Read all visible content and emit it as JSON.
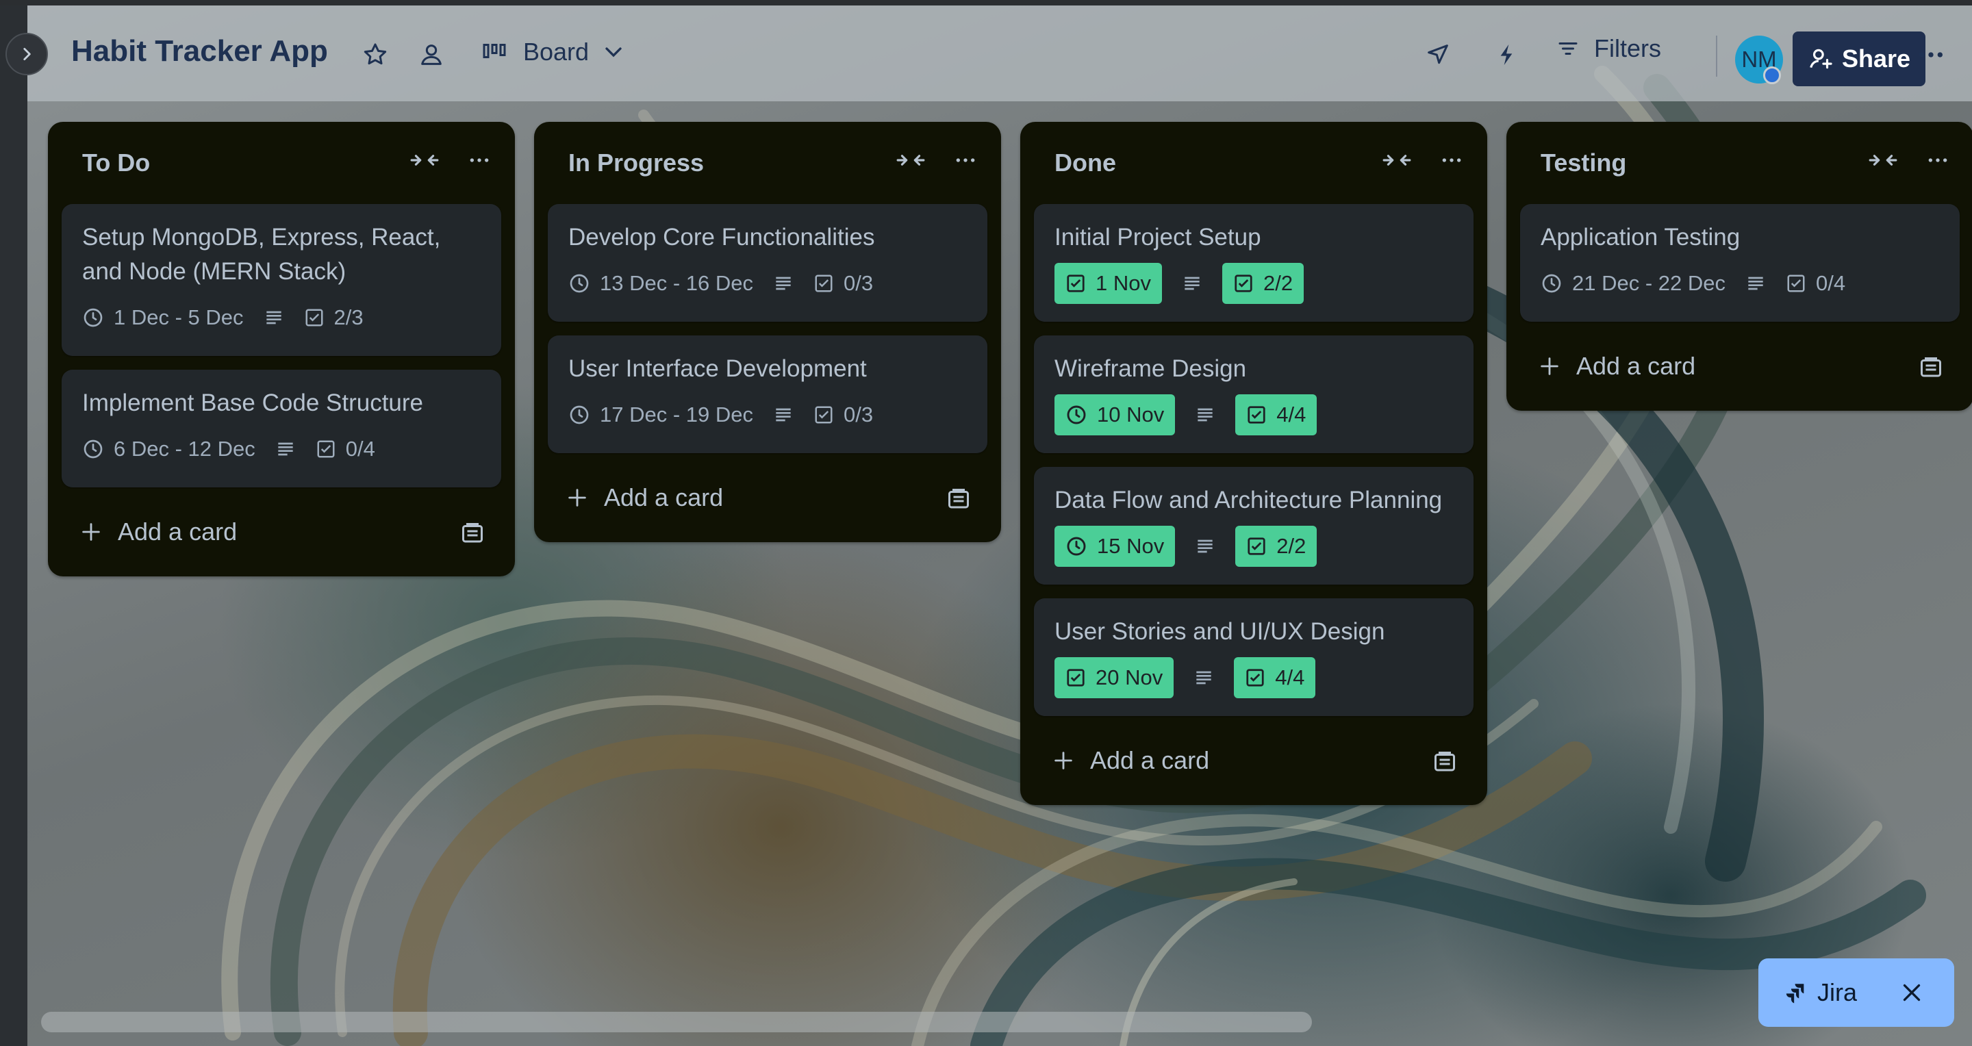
{
  "header": {
    "board_title": "Habit Tracker App",
    "view_label": "Board",
    "filters_label": "Filters",
    "avatar_initials": "NM",
    "share_label": "Share"
  },
  "lists": [
    {
      "title": "To Do",
      "cards": [
        {
          "title": "Setup MongoDB, Express, React, and Node (MERN Stack)",
          "dates": "1 Dec - 5 Dec",
          "checklist": "2/3"
        },
        {
          "title": "Implement Base Code Structure",
          "dates": "6 Dec - 12 Dec",
          "checklist": "0/4"
        }
      ],
      "add_label": "Add a card"
    },
    {
      "title": "In Progress",
      "cards": [
        {
          "title": "Develop Core Functionalities",
          "dates": "13 Dec - 16 Dec",
          "checklist": "0/3"
        },
        {
          "title": "User Interface Development",
          "dates": "17 Dec - 19 Dec",
          "checklist": "0/3"
        }
      ],
      "add_label": "Add a card"
    },
    {
      "title": "Done",
      "cards": [
        {
          "title": "Initial Project Setup",
          "dates": "1 Nov",
          "checklist": "2/2"
        },
        {
          "title": "Wireframe Design",
          "dates": "10 Nov",
          "checklist": "4/4"
        },
        {
          "title": "Data Flow and Architecture Planning",
          "dates": "15 Nov",
          "checklist": "2/2"
        },
        {
          "title": "User Stories and UI/UX Design",
          "dates": "20 Nov",
          "checklist": "4/4"
        }
      ],
      "add_label": "Add a card"
    },
    {
      "title": "Testing",
      "cards": [
        {
          "title": "Application Testing",
          "dates": "21 Dec - 22 Dec",
          "checklist": "0/4"
        }
      ],
      "add_label": "Add a card"
    }
  ],
  "jira": {
    "label": "Jira"
  },
  "colors": {
    "complete_badge": "#4bce97",
    "list_bg": "#101204",
    "card_bg": "#22272b",
    "share_bg": "#1f2f4f"
  }
}
